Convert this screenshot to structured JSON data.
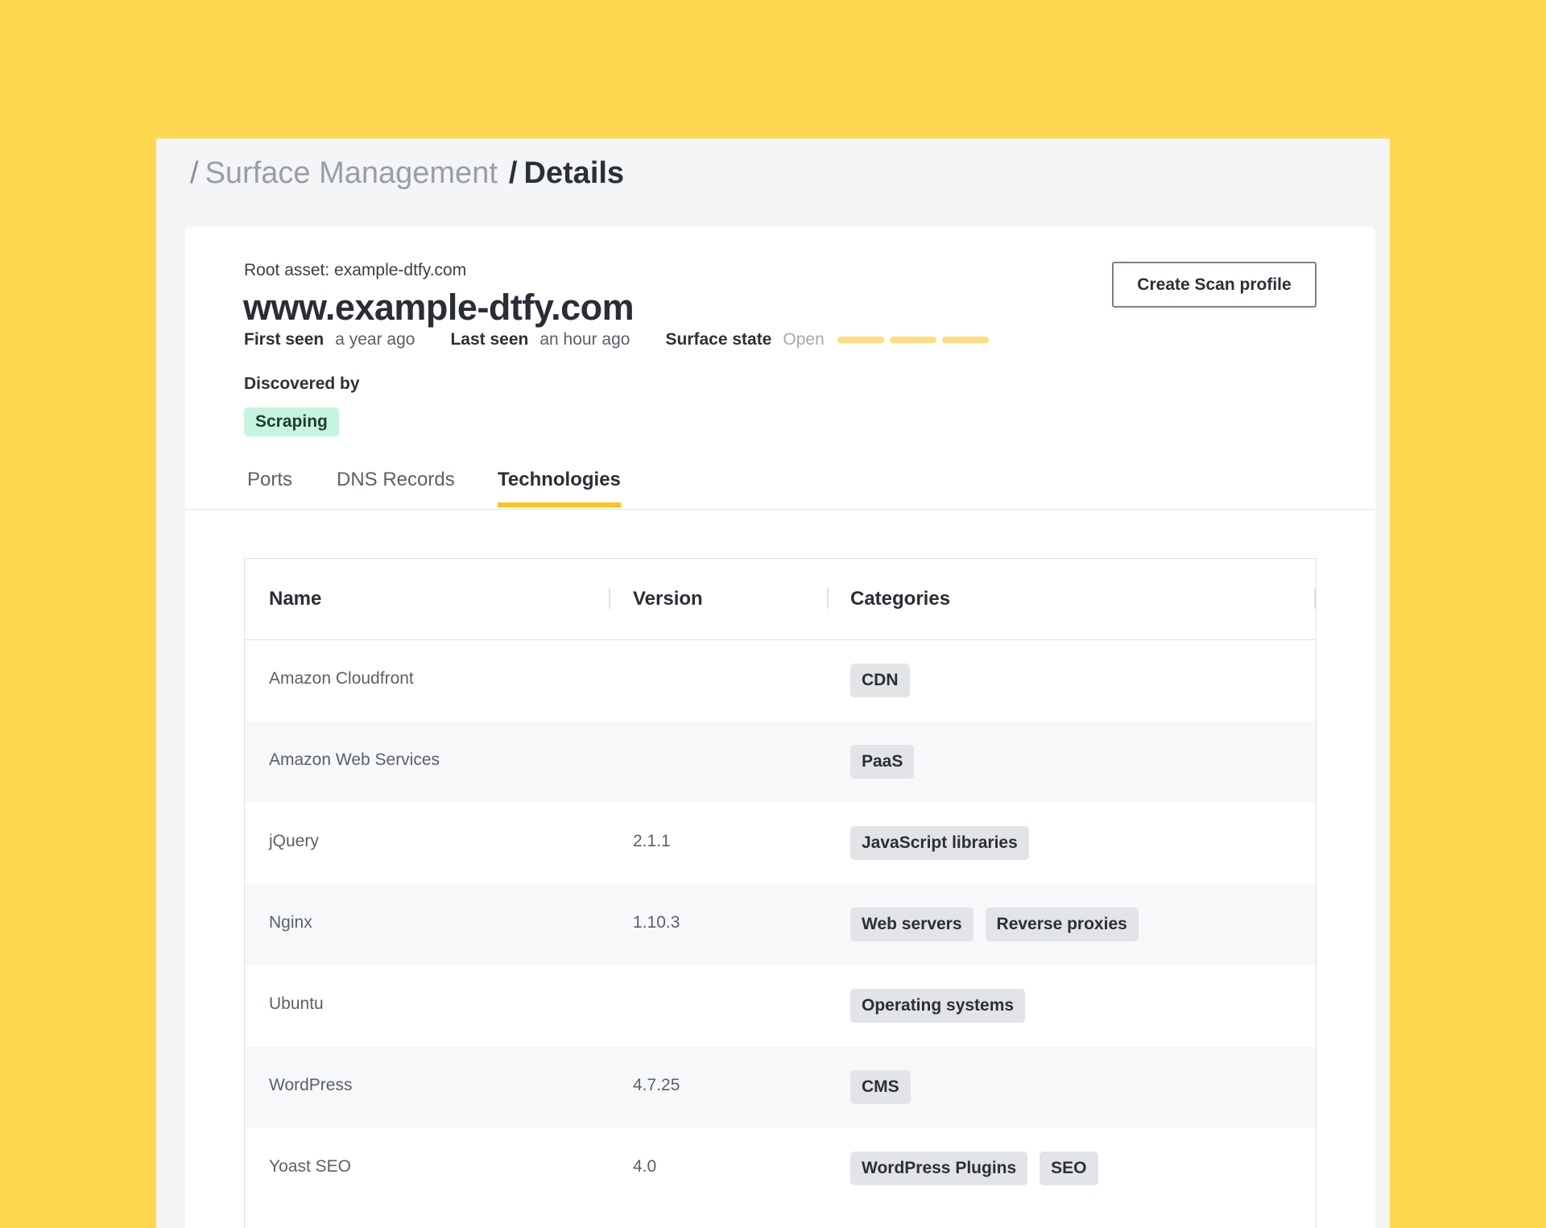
{
  "breadcrumb": {
    "sep1": "/",
    "section": "Surface Management",
    "sep2": "/",
    "current": "Details"
  },
  "asset": {
    "root_label": "Root asset: example-dtfy.com",
    "hostname": "www.example-dtfy.com",
    "first_seen_label": "First seen",
    "first_seen_value": "a year ago",
    "last_seen_label": "Last seen",
    "last_seen_value": "an hour ago",
    "surface_state_label": "Surface state",
    "surface_state_value": "Open",
    "surface_state_bar_color": "#FFDD80",
    "discovered_by_label": "Discovered by",
    "discovered_by_value": "Scraping"
  },
  "actions": {
    "create_scan_profile": "Create Scan profile"
  },
  "tabs": [
    {
      "label": "Ports",
      "active": false
    },
    {
      "label": "DNS Records",
      "active": false
    },
    {
      "label": "Technologies",
      "active": true
    }
  ],
  "table": {
    "columns": [
      "Name",
      "Version",
      "Categories"
    ],
    "rows": [
      {
        "name": "Amazon Cloudfront",
        "version": "",
        "categories": [
          "CDN"
        ]
      },
      {
        "name": "Amazon Web Services",
        "version": "",
        "categories": [
          "PaaS"
        ]
      },
      {
        "name": "jQuery",
        "version": "2.1.1",
        "categories": [
          "JavaScript libraries"
        ]
      },
      {
        "name": "Nginx",
        "version": "1.10.3",
        "categories": [
          "Web servers",
          "Reverse proxies"
        ]
      },
      {
        "name": "Ubuntu",
        "version": "",
        "categories": [
          "Operating systems"
        ]
      },
      {
        "name": "WordPress",
        "version": "4.7.25",
        "categories": [
          "CMS"
        ]
      },
      {
        "name": "Yoast SEO",
        "version": "4.0",
        "categories": [
          "WordPress Plugins",
          "SEO"
        ]
      }
    ]
  },
  "colors": {
    "background": "#FFD84F",
    "accent": "#FFC21A",
    "badge_green": "#C6F5DF"
  }
}
